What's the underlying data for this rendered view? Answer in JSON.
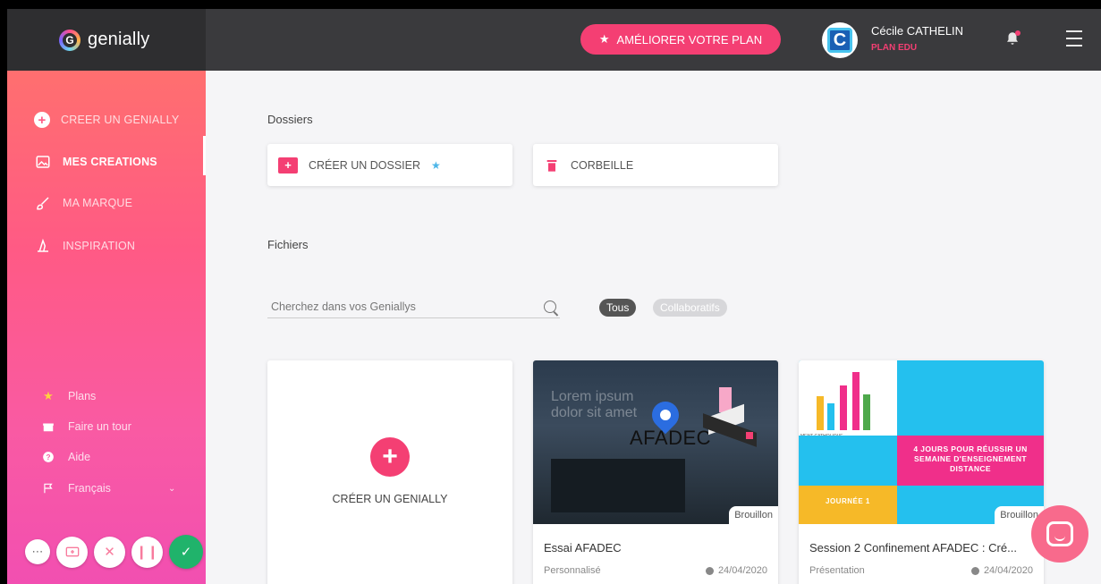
{
  "brand": {
    "name": "genially",
    "accent": "#f43f73"
  },
  "topbar": {
    "upgrade_label": "AMÉLIORER VOTRE PLAN",
    "user_name": "Cécile CATHELIN",
    "user_plan": "PLAN EDU"
  },
  "sidebar": {
    "items": [
      {
        "label": "CREER UN GENIALLY",
        "icon": "plus-circle-icon"
      },
      {
        "label": "MES CREATIONS",
        "icon": "image-icon",
        "active": true
      },
      {
        "label": "MA MARQUE",
        "icon": "brush-icon"
      },
      {
        "label": "INSPIRATION",
        "icon": "witch-hat-icon"
      }
    ],
    "bottom": [
      {
        "label": "Plans",
        "icon": "star-icon"
      },
      {
        "label": "Faire un tour",
        "icon": "gift-icon"
      },
      {
        "label": "Aide",
        "icon": "help-icon"
      },
      {
        "label": "Français",
        "icon": "flag-icon"
      }
    ]
  },
  "main": {
    "folders_label": "Dossiers",
    "create_folder": "CRÉER UN DOSSIER",
    "trash": "CORBEILLE",
    "files_label": "Fichiers",
    "search_placeholder": "Cherchez dans vos Geniallys",
    "filters": [
      "Tous",
      "Collaboratifs"
    ],
    "create_card_label": "CRÉER UN GENIALLY",
    "cards": [
      {
        "title": "Essai AFADEC",
        "type": "Personnalisé",
        "date": "24/04/2020",
        "badge": "Brouillon",
        "thumb_text": "AFADEC",
        "thumb_lorem": "Lorem ipsum\ndolor sit amet"
      },
      {
        "title": "Session 2 Confinement AFADEC : Cré...",
        "type": "Présentation",
        "date": "24/04/2020",
        "badge": "Brouillon",
        "thumb_banner": "4 JOURS POUR RÉUSSIR UN SEMAINE D'ENSEIGNEMENT DISTANCE",
        "thumb_day": "JOURNÉE 1",
        "thumb_caption": "MENT CATHOLIQUE"
      }
    ]
  }
}
